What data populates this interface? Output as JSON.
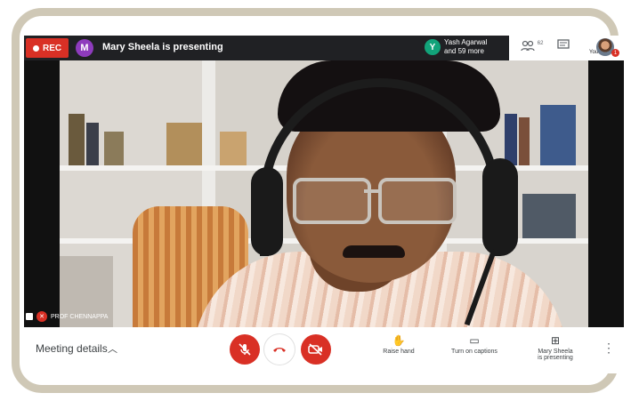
{
  "topbar": {
    "rec_label": "REC",
    "presenter_initial": "M",
    "presenting_text": "Mary Sheela is presenting",
    "participant_initial": "Y",
    "participant_name": "Yash Agarwal",
    "participant_more": "and 59 more",
    "people_count": "62",
    "you_label": "You",
    "notification_count": "1"
  },
  "video": {
    "speaker_name": "PROF CHENNAPPA"
  },
  "bottombar": {
    "meeting_details": "Meeting details",
    "raise_hand": "Raise hand",
    "captions": "Turn on captions",
    "presenting_line1": "Mary Sheela",
    "presenting_line2": "is presenting"
  },
  "colors": {
    "danger": "#d93025",
    "topbar_bg": "#202124",
    "frame": "#cfc8b6"
  }
}
